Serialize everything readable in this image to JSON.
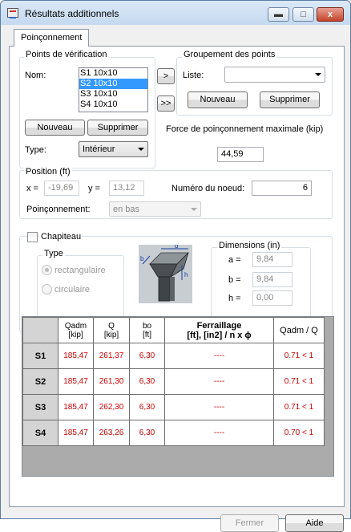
{
  "window": {
    "title": "Résultats additionnels",
    "minimize_label": "▬",
    "maximize_label": "□",
    "close_label": "x"
  },
  "tab": {
    "label": "Poinçonnement"
  },
  "points": {
    "legend": "Points de vérification",
    "nom_label": "Nom:",
    "items": [
      "S1 10x10",
      "S2 10x10",
      "S3 10x10",
      "S4 10x10"
    ],
    "selected_index": 1,
    "nouveau": "Nouveau",
    "supprimer": "Supprimer",
    "type_label": "Type:",
    "type_value": "Intérieur"
  },
  "transfer": {
    "one": ">",
    "all": ">>"
  },
  "groupement": {
    "legend": "Groupement des points",
    "liste_label": "Liste:",
    "liste_value": "",
    "nouveau": "Nouveau",
    "supprimer": "Supprimer"
  },
  "force": {
    "label": "Force de poinçonnement maximale (kip)",
    "value": "44,59"
  },
  "position": {
    "legend": "Position (ft)",
    "x_label": "x =",
    "x_value": "-19,69",
    "y_label": "y =",
    "y_value": "13,12",
    "noeud_label": "Numéro du noeud:",
    "noeud_value": "6",
    "poinc_label": "Poinçonnement:",
    "poinc_value": "en bas"
  },
  "chapiteau": {
    "label": "Chapiteau",
    "checked": false,
    "type_legend": "Type",
    "rect_label": "rectangulaire",
    "circ_label": "circulaire",
    "diagram_labels": {
      "d": "d",
      "b": "b",
      "h": "h"
    },
    "dims_legend": "Dimensions (in)",
    "a_label": "a =",
    "a_value": "9,84",
    "b_label": "b =",
    "b_value": "9,84",
    "h_label": "h =",
    "h_value": "0,00"
  },
  "table": {
    "headers": {
      "qadm": [
        "Qadm",
        "[kip]"
      ],
      "q": [
        "Q",
        "[kip]"
      ],
      "bo": [
        "bo",
        "[ft]"
      ],
      "ferr": [
        "Ferraillage",
        "[ft], [in2] / n x ϕ"
      ],
      "ratio": [
        "Qadm / Q"
      ]
    },
    "rows": [
      {
        "name": "S1",
        "qadm": "185,47",
        "q": "261,37",
        "bo": "6,30",
        "ferr": "----",
        "ratio": "0.71 < 1"
      },
      {
        "name": "S2",
        "qadm": "185,47",
        "q": "261,30",
        "bo": "6,30",
        "ferr": "----",
        "ratio": "0.71 < 1"
      },
      {
        "name": "S3",
        "qadm": "185,47",
        "q": "262,30",
        "bo": "6,30",
        "ferr": "----",
        "ratio": "0.71 < 1"
      },
      {
        "name": "S4",
        "qadm": "185,47",
        "q": "263,26",
        "bo": "6,30",
        "ferr": "----",
        "ratio": "0.70 < 1"
      }
    ]
  },
  "footer": {
    "fermer": "Fermer",
    "aide": "Aide"
  }
}
